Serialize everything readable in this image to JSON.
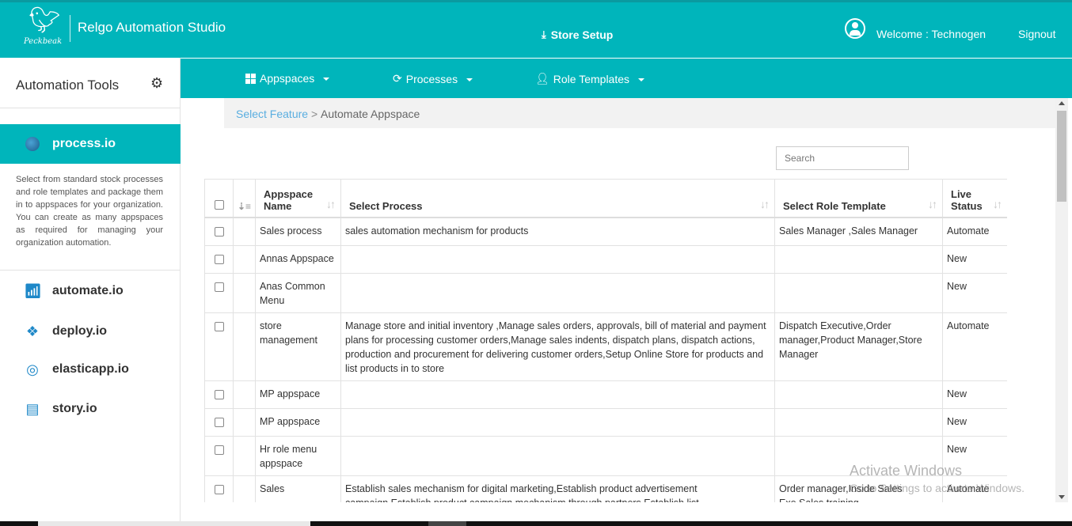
{
  "header": {
    "logo_text": "Peckbeak",
    "app_title": "Relgo Automation Studio",
    "store_setup": "Store Setup",
    "welcome": "Welcome : Technogen",
    "signout": "Signout"
  },
  "sidebar": {
    "title": "Automation Tools",
    "active": "process.io",
    "description": "Select from standard stock processes and role templates and package them in to appspaces for your organization. You can create as many appspaces as required for managing your organization automation.",
    "items": [
      {
        "label": "automate.io",
        "icon": "signal-icon"
      },
      {
        "label": "deploy.io",
        "icon": "ribbon-icon"
      },
      {
        "label": "elasticapp.io",
        "icon": "ring-icon"
      },
      {
        "label": "story.io",
        "icon": "document-icon"
      }
    ]
  },
  "subnav": {
    "appspaces": "Appspaces",
    "processes": "Processes",
    "role_templates": "Role Templates"
  },
  "breadcrumb": {
    "feature": "Select Feature",
    "sep": ">",
    "current": "Automate Appspace"
  },
  "search": {
    "placeholder": "Search"
  },
  "table": {
    "headers": {
      "appspace_name": "Appspace Name",
      "select_process": "Select Process",
      "select_role_template": "Select Role Template",
      "live_status": "Live Status"
    },
    "rows": [
      {
        "name": "Sales process",
        "process": "sales automation mechanism for products",
        "role": "Sales Manager ,Sales Manager",
        "status": "Automate"
      },
      {
        "name": "Annas Appspace",
        "process": "",
        "role": "",
        "status": "New"
      },
      {
        "name": "Anas Common Menu",
        "process": "",
        "role": "",
        "status": "New"
      },
      {
        "name": "store management",
        "process": "Manage store and initial inventory ,Manage sales orders, approvals, bill of material and payment plans for processing customer orders,Manage sales indents, dispatch plans, dispatch actions, production and procurement for delivering customer orders,Setup Online Store for products and list products in to store",
        "role": "Dispatch Executive,Order manager,Product Manager,Store Manager",
        "status": "Automate"
      },
      {
        "name": "MP appspace",
        "process": "",
        "role": "",
        "status": "New"
      },
      {
        "name": "MP appspace",
        "process": "",
        "role": "",
        "status": "New"
      },
      {
        "name": "Hr role menu appspace",
        "process": "",
        "role": "",
        "status": "New"
      },
      {
        "name": "Sales",
        "process": "Establish sales mechanism for digital marketing,Establish product advertisement campaign,Establish product campaign mechanism through partners,Establish list",
        "role": "Order manager,Inside Sales Exe,Sales training",
        "status": "Automate"
      }
    ]
  },
  "watermark": {
    "line1": "Activate Windows",
    "line2": "Go to Settings to activate Windows."
  },
  "colors": {
    "brand": "#00b5bb",
    "link": "#5aaee0"
  }
}
